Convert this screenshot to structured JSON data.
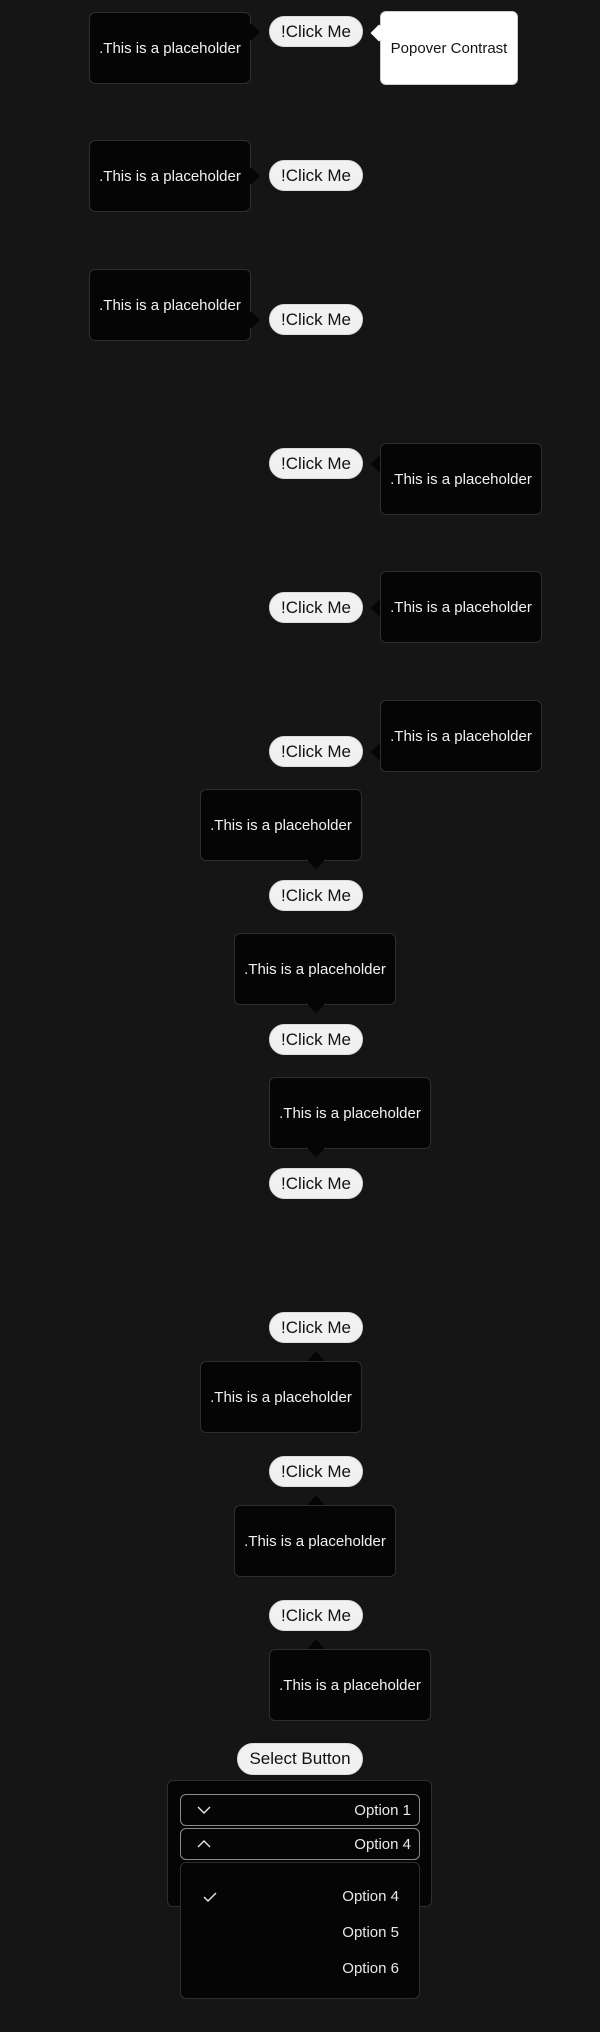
{
  "buttons": {
    "click_label": "!Click Me",
    "select_label": "Select Button"
  },
  "popovers": {
    "placeholder": ".This is a placeholder",
    "contrast": "Popover Contrast"
  },
  "select": {
    "rows": [
      {
        "label": "Option 1",
        "icon": "chevron-down-icon"
      },
      {
        "label": "Option 4",
        "icon": "chevron-up-icon"
      }
    ],
    "options": [
      {
        "label": "Option 4",
        "selected": true
      },
      {
        "label": "Option 5",
        "selected": false
      },
      {
        "label": "Option 6",
        "selected": false
      }
    ]
  },
  "colors": {
    "background": "#151515",
    "popover_bg": "#050505",
    "button_bg": "#f1f1f1",
    "contrast_popover_bg": "#ffffff"
  }
}
